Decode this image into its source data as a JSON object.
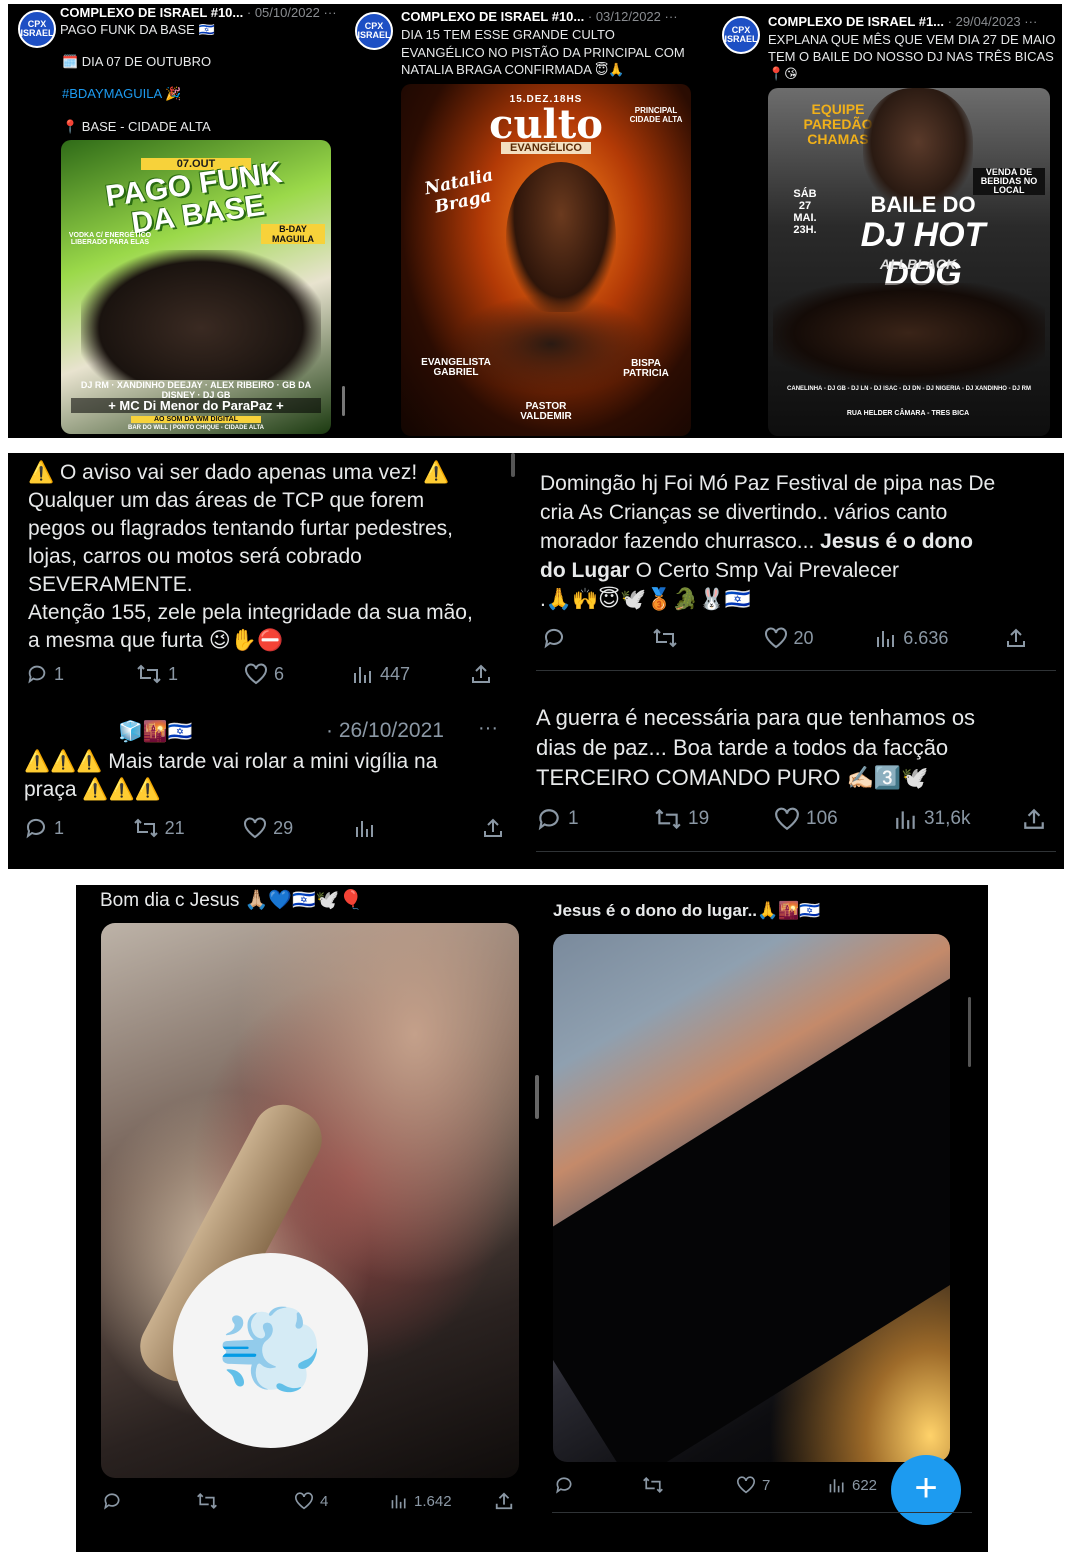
{
  "panel1": {
    "posts": [
      {
        "avatar": "CPX ISRAEL",
        "name": "COMPLEXO DE ISRAEL #10...",
        "date": "· 05/10/2022",
        "more": "···",
        "line1": "PAGO FUNK DA BASE 🇮🇱",
        "line2": "🗓️ DIA 07 DE OUTUBRO",
        "line3": "#BDAYMAGUILA 🎉",
        "line4": "📍 BASE - CIDADE ALTA",
        "poster": {
          "date": "07.OUT",
          "title": "PAGO FUNK DA BASE",
          "bday": "B-DAY MAGUILA",
          "promo": "VODKA C/ ENERGÉTICO LIBERADO PARA ELAS",
          "djs": "DJ RM · XANDINHO DEEJAY · ALEX RIBEIRO · GB DA DISNEY · DJ GB",
          "mc": "+ MC Di Menor do ParaPaz +",
          "sound": "AO SOM DA WM DIGITAL",
          "place": "BAR DO WILL | PONTO CHIQUE - CIDADE ALTA"
        }
      },
      {
        "avatar": "CPX ISRAEL",
        "name": "COMPLEXO DE ISRAEL #10...",
        "date": "· 03/12/2022",
        "more": "···",
        "line1": "DIA 15 TEM ESSE GRANDE CULTO",
        "line2": "EVANGÉLICO NO PISTÃO DA PRINCIPAL COM",
        "line3": "NATALIA BRAGA CONFIRMADA 😇🙏",
        "poster": {
          "date": "15.DEZ.18HS",
          "title": "culto",
          "subtitle": "EVANGÉLICO",
          "place": "PRINCIPAL CIDADE ALTA",
          "guest": "Natalia Braga",
          "left": "EVANGELISTA GABRIEL",
          "center": "PASTOR VALDEMIR",
          "right": "BISPA PATRICIA"
        }
      },
      {
        "avatar": "CPX ISRAEL",
        "name": "COMPLEXO DE ISRAEL #1...",
        "date": "· 29/04/2023",
        "more": "···",
        "line1": "EXPLANA QUE MÊS QUE VEM DIA 27 DE MAIO",
        "line2": "TEM O BAILE DO NOSSO DJ NAS TRÊS BICAS",
        "line3": "📍😘",
        "poster": {
          "team": "EQUIPE PAREDÃO CHAMAS",
          "sale": "VENDA DE BEBIDAS NO LOCAL",
          "day": "SÁB 27 MAI. 23H.",
          "title1": "BAILE DO",
          "title2": "DJ HOT DOG",
          "title3": "ALLBLACK",
          "djs": "CANELINHA - DJ GB - DJ LN - DJ ISAC - DJ DN - DJ NIGERIA - DJ XANDINHO - DJ RM",
          "place": "RUA HELDER CÂMARA - TRES BICA"
        }
      }
    ]
  },
  "panel2": {
    "t1": {
      "l1": "⚠️ O aviso vai ser dado apenas uma vez! ⚠️",
      "l2": "Qualquer um das áreas de TCP que forem",
      "l3": "pegos ou flagrados tentando furtar pedestres,",
      "l4": "lojas, carros ou motos será cobrado",
      "l5": "SEVERAMENTE.",
      "l6": "Atenção 155, zele pela integridade da sua mão,",
      "l7": "a mesma que furta 😉✋⛔",
      "replies": "1",
      "reposts": "1",
      "likes": "6",
      "views": "447"
    },
    "t2": {
      "flags": "🧊🌇🇮🇱",
      "date": "· 26/10/2021",
      "more": "···",
      "l1": "⚠️⚠️⚠️ Mais tarde vai rolar a mini vigília na",
      "l2": "praça ⚠️⚠️⚠️",
      "replies": "1",
      "reposts": "21",
      "likes": "29",
      "views": ""
    },
    "t3": {
      "l1": "Domingão hj Foi Mó Paz Festival de pipa nas De",
      "l2": "cria As Crianças se divertindo.. vários canto",
      "l3a": "morador fazendo churrasco... ",
      "l3b": "Jesus é o dono",
      "l4a": "do Lugar",
      "l4b": " O Certo Smp Vai Prevalecer",
      "l5": ".🙏🙌😇🕊️🥉🐊🐰🇮🇱",
      "replies": "",
      "reposts": "",
      "likes": "20",
      "views": "6.636"
    },
    "t4": {
      "l1": "A guerra é necessária para que tenhamos os",
      "l2": "dias de paz... Boa tarde a todos da facção",
      "l3": "TERCEIRO COMANDO PURO ✍🏻3️⃣🕊️",
      "replies": "1",
      "reposts": "19",
      "likes": "106",
      "views": "31,6k"
    }
  },
  "panel3": {
    "left": {
      "caption": "Bom dia c Jesus 🙏🏼💙🇮🇱🕊️🎈",
      "sticker": "💨",
      "replies": "",
      "reposts": "",
      "likes": "4",
      "views": "1.642"
    },
    "right": {
      "caption": "Jesus é o dono do lugar..🙏🌇🇮🇱",
      "replies": "",
      "reposts": "",
      "likes": "7",
      "views": "622",
      "fab": "+"
    }
  },
  "icons": {
    "reply": "reply-icon",
    "repost": "repost-icon",
    "like": "heart-icon",
    "views": "views-icon",
    "share": "share-icon"
  }
}
